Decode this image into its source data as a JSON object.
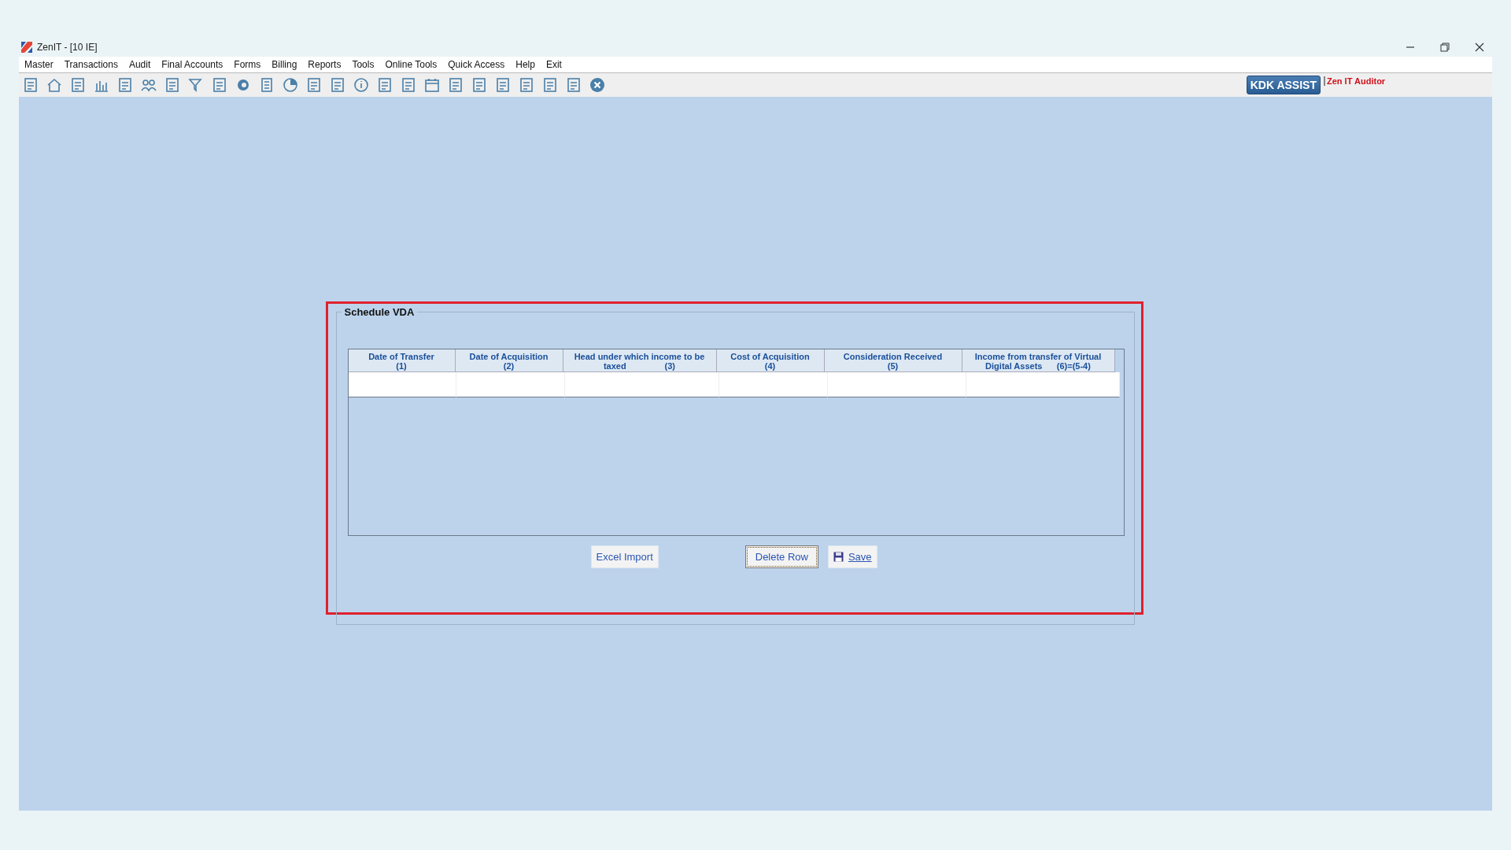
{
  "window": {
    "title": "ZenIT - [10 IE]"
  },
  "menu": [
    "Master",
    "Transactions",
    "Audit",
    "Final Accounts",
    "Forms",
    "Billing",
    "Reports",
    "Tools",
    "Online Tools",
    "Quick Access",
    "Help",
    "Exit"
  ],
  "toolbar": {
    "assist_button": "KDK ASSIST",
    "product_label": "Zen IT Auditor"
  },
  "schedule": {
    "title": "Schedule VDA",
    "columns": [
      "Date of Transfer\n(1)",
      "Date of Acquisition\n(2)",
      "Head under which income to be\ntaxed                (3)",
      "Cost of Acquisition\n(4)",
      "Consideration Received\n(5)",
      "Income from transfer of Virtual\nDigital Assets      (6)=(5-4)"
    ],
    "buttons": [
      {
        "label": "Excel Import",
        "kind": "plain",
        "focused": false
      },
      {
        "label": "Delete Row",
        "kind": "plain",
        "focused": true
      },
      {
        "label": "Save",
        "kind": "save",
        "focused": false
      }
    ]
  }
}
